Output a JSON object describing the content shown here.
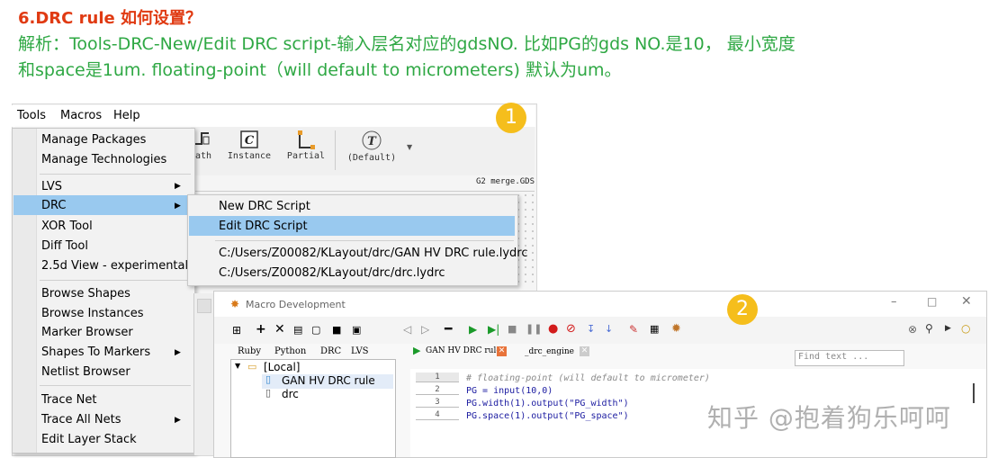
{
  "heading": "6.DRC rule 如何设置？",
  "desc_line1": "解析：Tools-DRC-New/Edit DRC script-输入层名对应的gdsNO. 比如PG的gds NO.是10，  最小宽度",
  "desc_line2": "和space是1um. floating-point（will default to micrometers) 默认为um。",
  "menubar": {
    "tools": "Tools",
    "macros": "Macros",
    "help": "Help"
  },
  "toolbar": {
    "path": "Path",
    "instance": "Instance",
    "partial": "Partial",
    "default": "(Default)"
  },
  "layout_file": "G2 merge.GDS",
  "tools_menu": {
    "manage_packages": "Manage Packages",
    "manage_technologies": "Manage Technologies",
    "lvs": "LVS",
    "drc": "DRC",
    "xor_tool": "XOR Tool",
    "diff_tool": "Diff Tool",
    "view_25d": "2.5d View - experimental",
    "browse_shapes": "Browse Shapes",
    "browse_instances": "Browse Instances",
    "marker_browser": "Marker Browser",
    "shapes_to_markers": "Shapes To Markers",
    "netlist_browser": "Netlist Browser",
    "trace_net": "Trace Net",
    "trace_all_nets": "Trace All Nets",
    "edit_layer_stack": "Edit Layer Stack"
  },
  "drc_submenu": {
    "new_script": "New DRC Script",
    "edit_script": "Edit DRC Script",
    "recent1": "C:/Users/Z00082/KLayout/drc/GAN HV DRC rule.lydrc",
    "recent2": "C:/Users/Z00082/KLayout/drc/drc.lydrc"
  },
  "badge1": "1",
  "badge2": "2",
  "macro_window": {
    "title": "Macro Development",
    "find_placeholder": "Find text ...",
    "lang_tabs": [
      "Ruby",
      "Python",
      "DRC",
      "LVS"
    ],
    "tree_root": "[Local]",
    "tree_items": [
      "GAN HV DRC rule",
      "drc"
    ],
    "file_tabs": [
      "GAN HV DRC rule",
      "_drc_engine"
    ],
    "line_numbers": [
      "1",
      "2",
      "3",
      "4"
    ],
    "code_lines": [
      "# floating-point (will default to micrometer)",
      "PG = input(10,0)",
      "PG.width(1).output(\"PG_width\")",
      "PG.space(1).output(\"PG_space\")"
    ]
  },
  "watermark": "知乎 @抱着狗乐呵呵",
  "colors": {
    "heading": "#e03a12",
    "description": "#2fa844",
    "highlight": "#99c9ef",
    "badge": "#f5be1c"
  }
}
